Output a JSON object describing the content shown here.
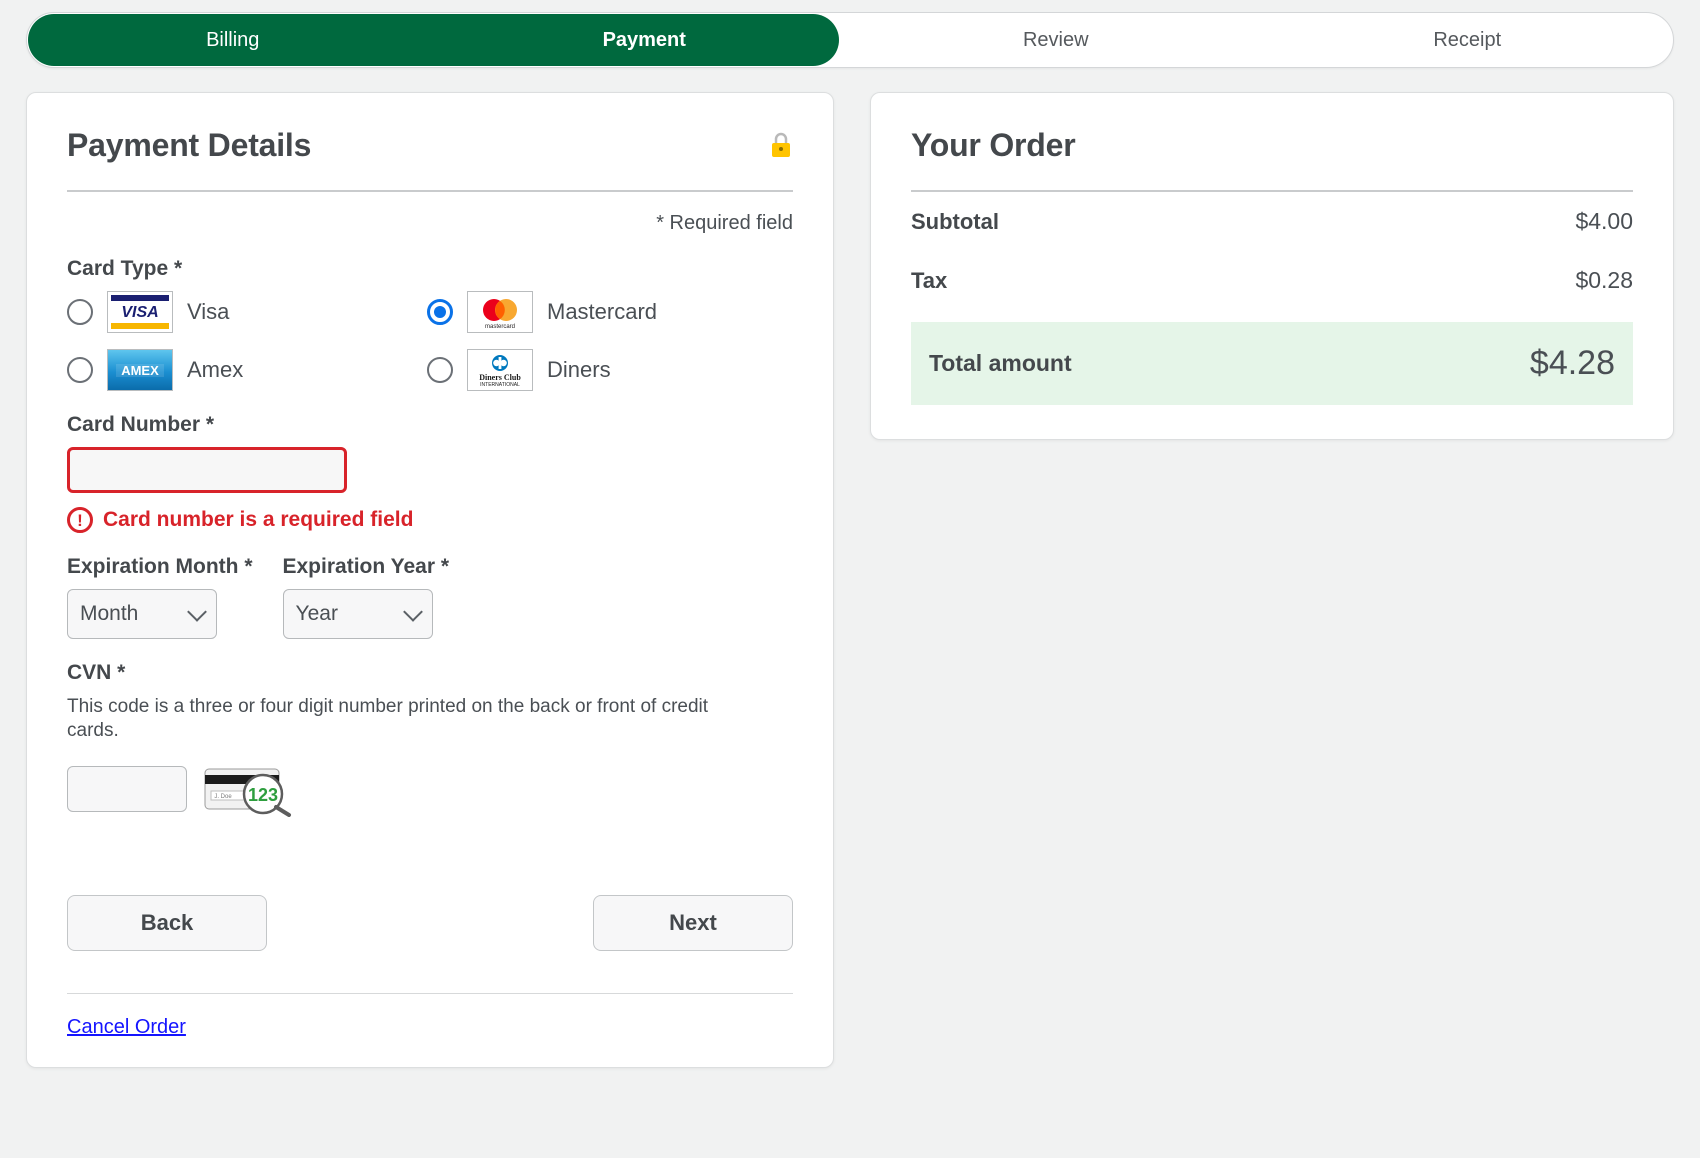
{
  "steps": [
    {
      "label": "Billing",
      "state": "done"
    },
    {
      "label": "Payment",
      "state": "active"
    },
    {
      "label": "Review",
      "state": "upcoming"
    },
    {
      "label": "Receipt",
      "state": "upcoming"
    }
  ],
  "payment": {
    "title": "Payment Details",
    "lock_icon": "lock-icon",
    "required_note": "* Required field",
    "card_type_label": "Card Type *",
    "card_types": [
      {
        "label": "Visa",
        "logo": "visa-logo",
        "selected": false
      },
      {
        "label": "Mastercard",
        "logo": "mastercard-logo",
        "selected": true
      },
      {
        "label": "Amex",
        "logo": "amex-logo",
        "selected": false
      },
      {
        "label": "Diners",
        "logo": "diners-logo",
        "selected": false
      }
    ],
    "card_number_label": "Card Number *",
    "card_number_value": "",
    "card_number_error": "Card number is a required field",
    "expiration_month_label": "Expiration Month *",
    "expiration_month_value": "Month",
    "expiration_year_label": "Expiration Year *",
    "expiration_year_value": "Year",
    "cvn_label": "CVN *",
    "cvn_help": "This code is a three or four digit number printed on the back or front of credit cards.",
    "cvn_value": "",
    "cvn_hint_digits": "123",
    "back_label": "Back",
    "next_label": "Next",
    "cancel_label": "Cancel Order"
  },
  "order": {
    "title": "Your Order",
    "rows": [
      {
        "label": "Subtotal",
        "value": "$4.00"
      },
      {
        "label": "Tax",
        "value": "$0.28"
      }
    ],
    "total": {
      "label": "Total amount",
      "value": "$4.28"
    }
  },
  "colors": {
    "brand_green": "#00693e",
    "error_red": "#d8232a",
    "link_blue": "#1414ff",
    "radio_blue": "#0a72e8",
    "total_bg": "#e5f5e8"
  }
}
